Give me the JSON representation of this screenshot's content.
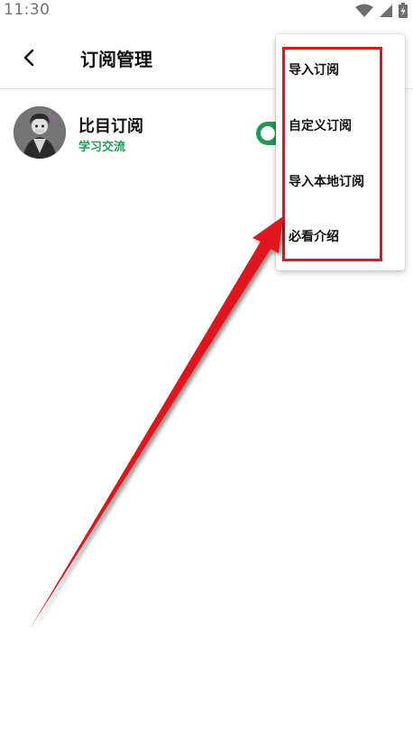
{
  "status_bar": {
    "time": "11:30",
    "icons": [
      "wifi-icon",
      "cell-signal-icon",
      "battery-charging-icon"
    ]
  },
  "app_bar": {
    "back_icon": "chevron-left-icon",
    "title": "订阅管理"
  },
  "subscriptions": [
    {
      "name": "比目订阅",
      "tag": "学习交流",
      "enabled": true,
      "tag_color": "#1d9e55",
      "toggle_color": "#1e9a56"
    }
  ],
  "popup_menu": {
    "items": [
      {
        "label": "导入订阅"
      },
      {
        "label": "自定义订阅"
      },
      {
        "label": "导入本地订阅"
      },
      {
        "label": "必看介绍"
      }
    ]
  },
  "annotation": {
    "highlight_color": "#e0161b",
    "arrow_color": "#e0161b"
  }
}
